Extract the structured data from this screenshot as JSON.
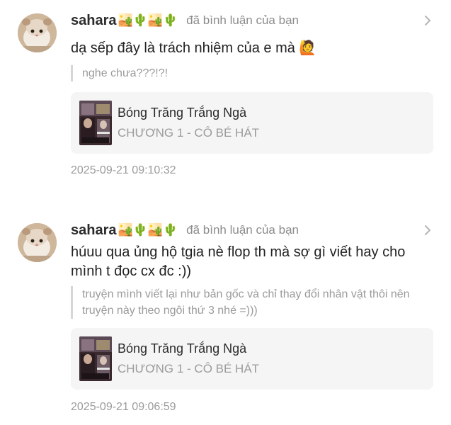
{
  "notifications": [
    {
      "username": "sahara",
      "user_emoji": "🏜️🌵🏜️🌵",
      "action": "đã bình luận của bạn",
      "comment": "dạ sếp đây là trách nhiệm của e mà 🙋",
      "quote": "nghe chưa???!?!",
      "story": {
        "title": "Bóng Trăng Trắng Ngà",
        "chapter": "CHƯƠNG 1 - CÔ BÉ HÁT"
      },
      "timestamp": "2025-09-21 09:10:32"
    },
    {
      "username": "sahara",
      "user_emoji": "🏜️🌵🏜️🌵",
      "action": "đã bình luận của bạn",
      "comment": "húuu qua ủng hộ tgia nè flop th mà sợ gì viết hay cho mình t đọc cx đc :))",
      "quote": "truyện mình viết lại như bản gốc và chỉ thay đổi nhân vật thôi nên truyện này theo ngôi thứ 3 nhé =)))",
      "story": {
        "title": "Bóng Trăng Trắng Ngà",
        "chapter": "CHƯƠNG 1 - CÔ BÉ HÁT"
      },
      "timestamp": "2025-09-21 09:06:59"
    }
  ],
  "colors": {
    "secondary_text": "#9b9b9b",
    "card_background": "#f5f5f5",
    "quote_border": "#d6d6d6"
  },
  "icons": {
    "chevron": "chevron-right-icon",
    "avatar": "hamster-avatar"
  }
}
